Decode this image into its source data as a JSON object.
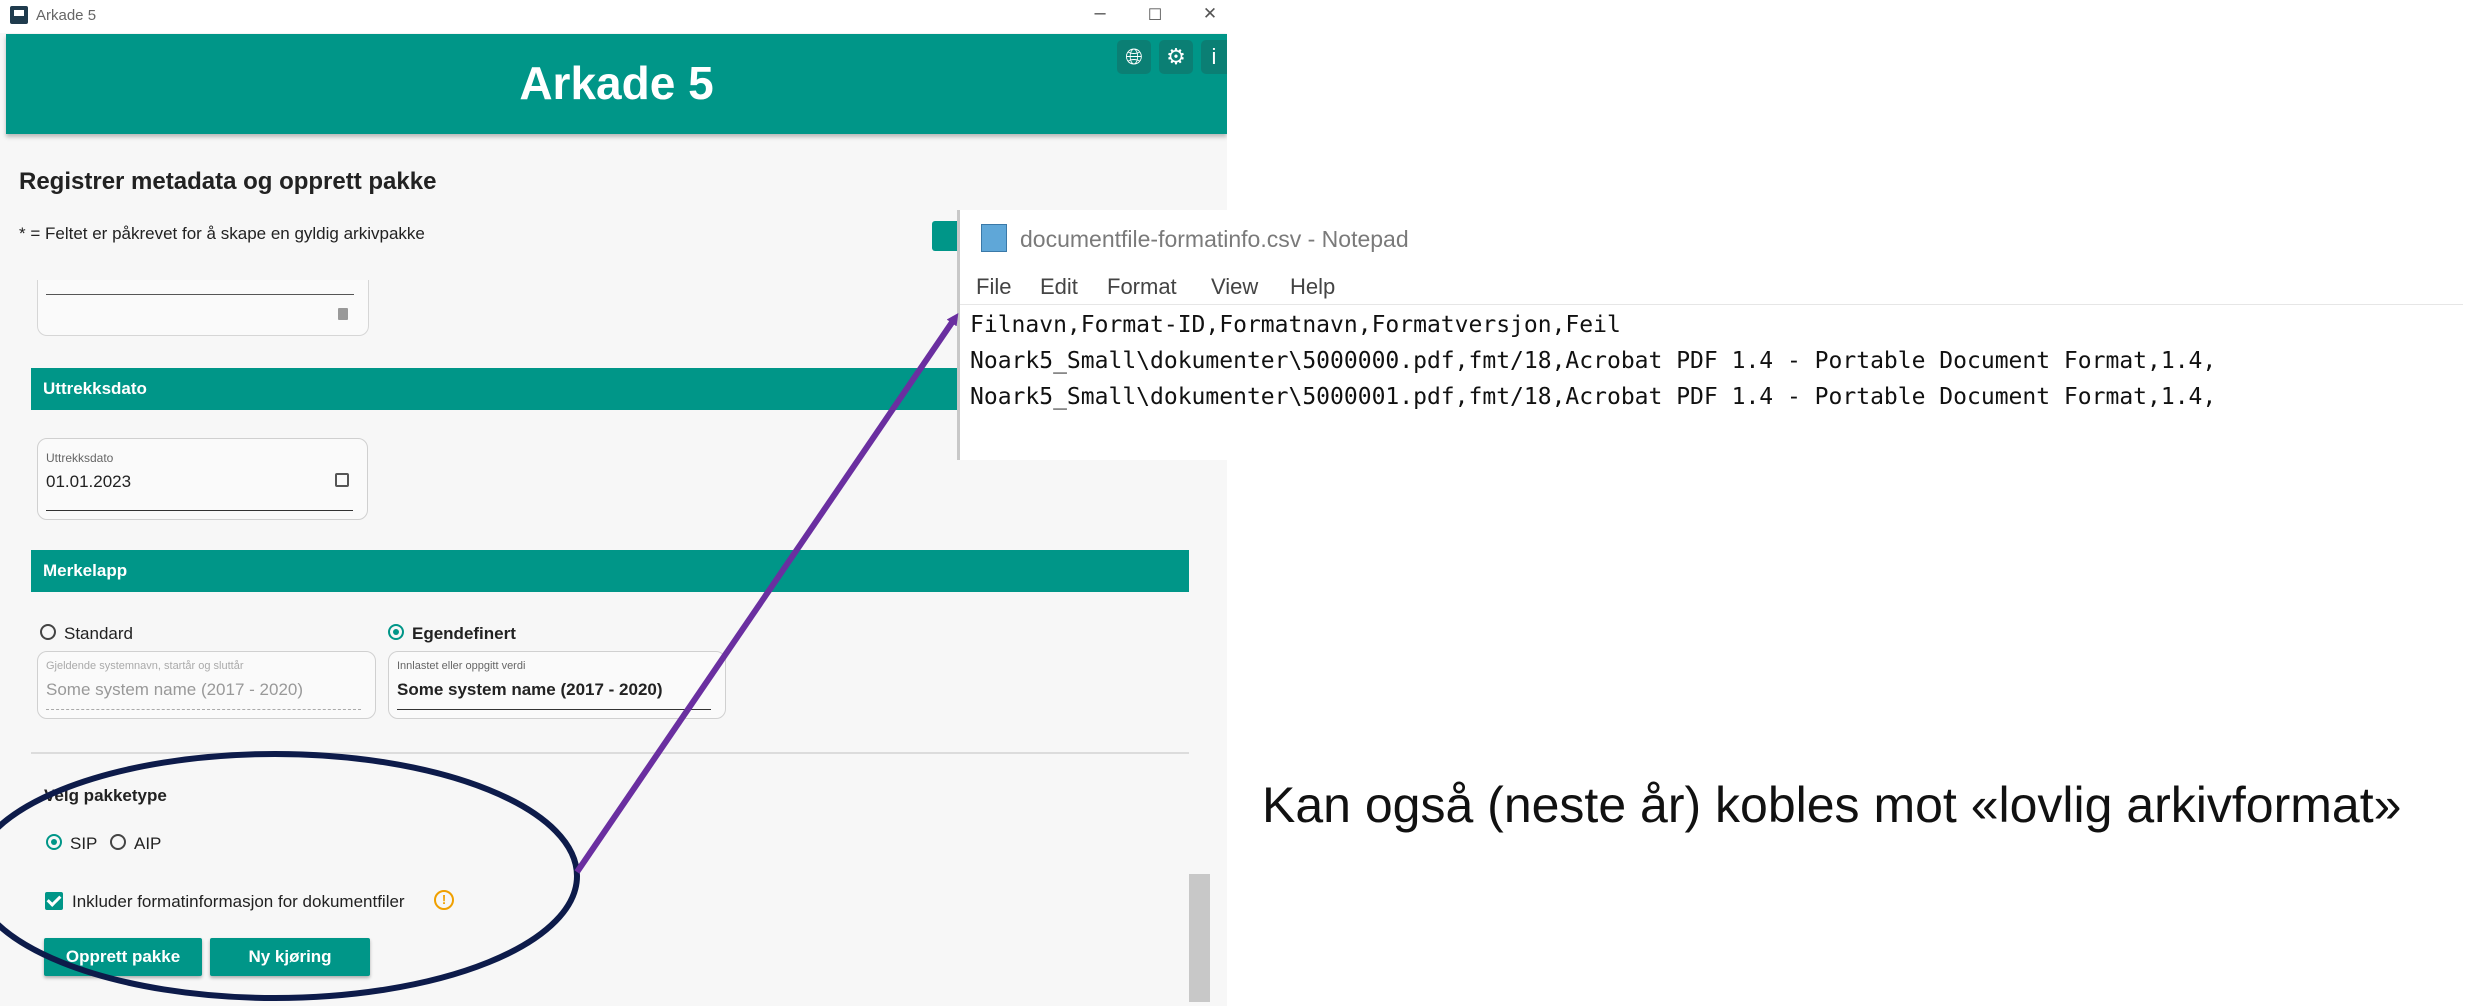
{
  "window": {
    "title": "Arkade 5",
    "minimize": "–",
    "maximize": "☐",
    "close": "✕"
  },
  "header": {
    "title": "Arkade 5"
  },
  "page": {
    "title": "Registrer metadata og opprett pakke",
    "required_note": "* = Feltet er påkrevet for å skape en gyldig arkivpakke"
  },
  "sections": {
    "extract_date": {
      "heading": "Uttrekksdato",
      "field_label": "Uttrekksdato",
      "field_value": "01.01.2023"
    },
    "tag": {
      "heading": "Merkelapp",
      "options": [
        "Standard",
        "Egendefinert"
      ],
      "selected": "Egendefinert",
      "standard_label": "Gjeldende systemnavn, startår og sluttår",
      "standard_value": "Some system name (2017 - 2020)",
      "custom_label": "Innlastet eller oppgitt verdi",
      "custom_value": "Some system name (2017 - 2020)"
    },
    "package": {
      "heading": "Velg pakketype",
      "options": [
        "SIP",
        "AIP"
      ],
      "selected": "SIP",
      "include_format_label": "Inkluder formatinformasjon for dokumentfiler",
      "include_format_checked": true,
      "warning_glyph": "!"
    }
  },
  "buttons": {
    "create": "Opprett pakke",
    "new_run": "Ny kjøring"
  },
  "notepad": {
    "title": "documentfile-formatinfo.csv - Notepad",
    "menu": [
      "File",
      "Edit",
      "Format",
      "View",
      "Help"
    ],
    "lines": [
      "Filnavn,Format-ID,Formatnavn,Formatversjon,Feil",
      "Noark5_Small\\dokumenter\\5000000.pdf,fmt/18,Acrobat PDF 1.4 - Portable Document Format,1.4,",
      "Noark5_Small\\dokumenter\\5000001.pdf,fmt/18,Acrobat PDF 1.4 - Portable Document Format,1.4,"
    ]
  },
  "caption": "Kan også (neste år) kobles mot «lovlig arkivformat»",
  "colors": {
    "accent": "#009688",
    "ellipse": "#0d1b4a",
    "arrow": "#6a2fa0",
    "warning": "#f0a000"
  },
  "icons": {
    "globe": "globe-icon",
    "settings": "gear-icon",
    "info": "info-icon"
  }
}
